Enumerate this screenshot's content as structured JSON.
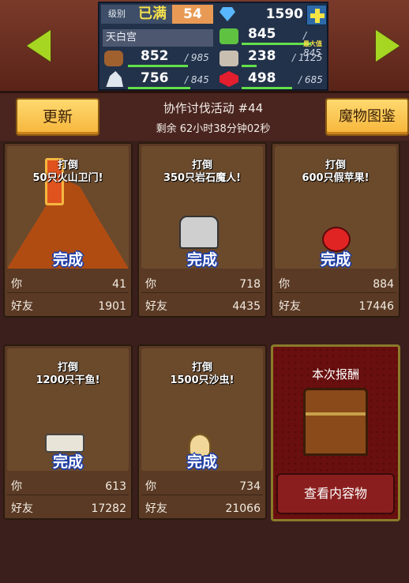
{
  "header": {
    "level_label": "级别",
    "level_max": "已满",
    "level": "54",
    "gems": "1590",
    "location": "天白宫",
    "max_tag": "最大值",
    "stats": [
      {
        "icon": "grass-icon",
        "value": "845",
        "max": "845",
        "progress": 1.0
      },
      {
        "icon": "wood-icon",
        "value": "852",
        "max": "985",
        "progress": 0.865
      },
      {
        "icon": "monster-icon",
        "value": "238",
        "max": "1125",
        "progress": 0.212
      },
      {
        "icon": "ore-icon",
        "value": "756",
        "max": "845",
        "progress": 0.895
      },
      {
        "icon": "ruby-icon",
        "value": "498",
        "max": "685",
        "progress": 0.727
      }
    ]
  },
  "banner": {
    "update_label": "更新",
    "title": "协作讨伐活动 #44",
    "remaining": "剩余 62小时38分钟02秒",
    "bestiary_label": "魔物图鉴"
  },
  "cards": [
    {
      "line1": "打倒",
      "line2": "50只火山卫门!",
      "status": "完成",
      "you_label": "你",
      "you": "41",
      "friend_label": "好友",
      "friend": "1901",
      "monster": "volcano"
    },
    {
      "line1": "打倒",
      "line2": "350只岩石魔人!",
      "status": "完成",
      "you_label": "你",
      "you": "718",
      "friend_label": "好友",
      "friend": "4435",
      "monster": "golem"
    },
    {
      "line1": "打倒",
      "line2": "600只假苹果!",
      "status": "完成",
      "you_label": "你",
      "you": "884",
      "friend_label": "好友",
      "friend": "17446",
      "monster": "apple"
    },
    {
      "line1": "打倒",
      "line2": "1200只干鱼!",
      "status": "完成",
      "you_label": "你",
      "you": "613",
      "friend_label": "好友",
      "friend": "17282",
      "monster": "fish"
    },
    {
      "line1": "打倒",
      "line2": "1500只沙虫!",
      "status": "完成",
      "you_label": "你",
      "you": "734",
      "friend_label": "好友",
      "friend": "21066",
      "monster": "worm"
    }
  ],
  "reward": {
    "title": "本次报酬",
    "button": "查看内容物"
  },
  "colors": {
    "accent_green": "#a6d622",
    "bar_green": "#63e04a",
    "done_blue": "#1d3ea8",
    "gold": "#f6b53a"
  }
}
